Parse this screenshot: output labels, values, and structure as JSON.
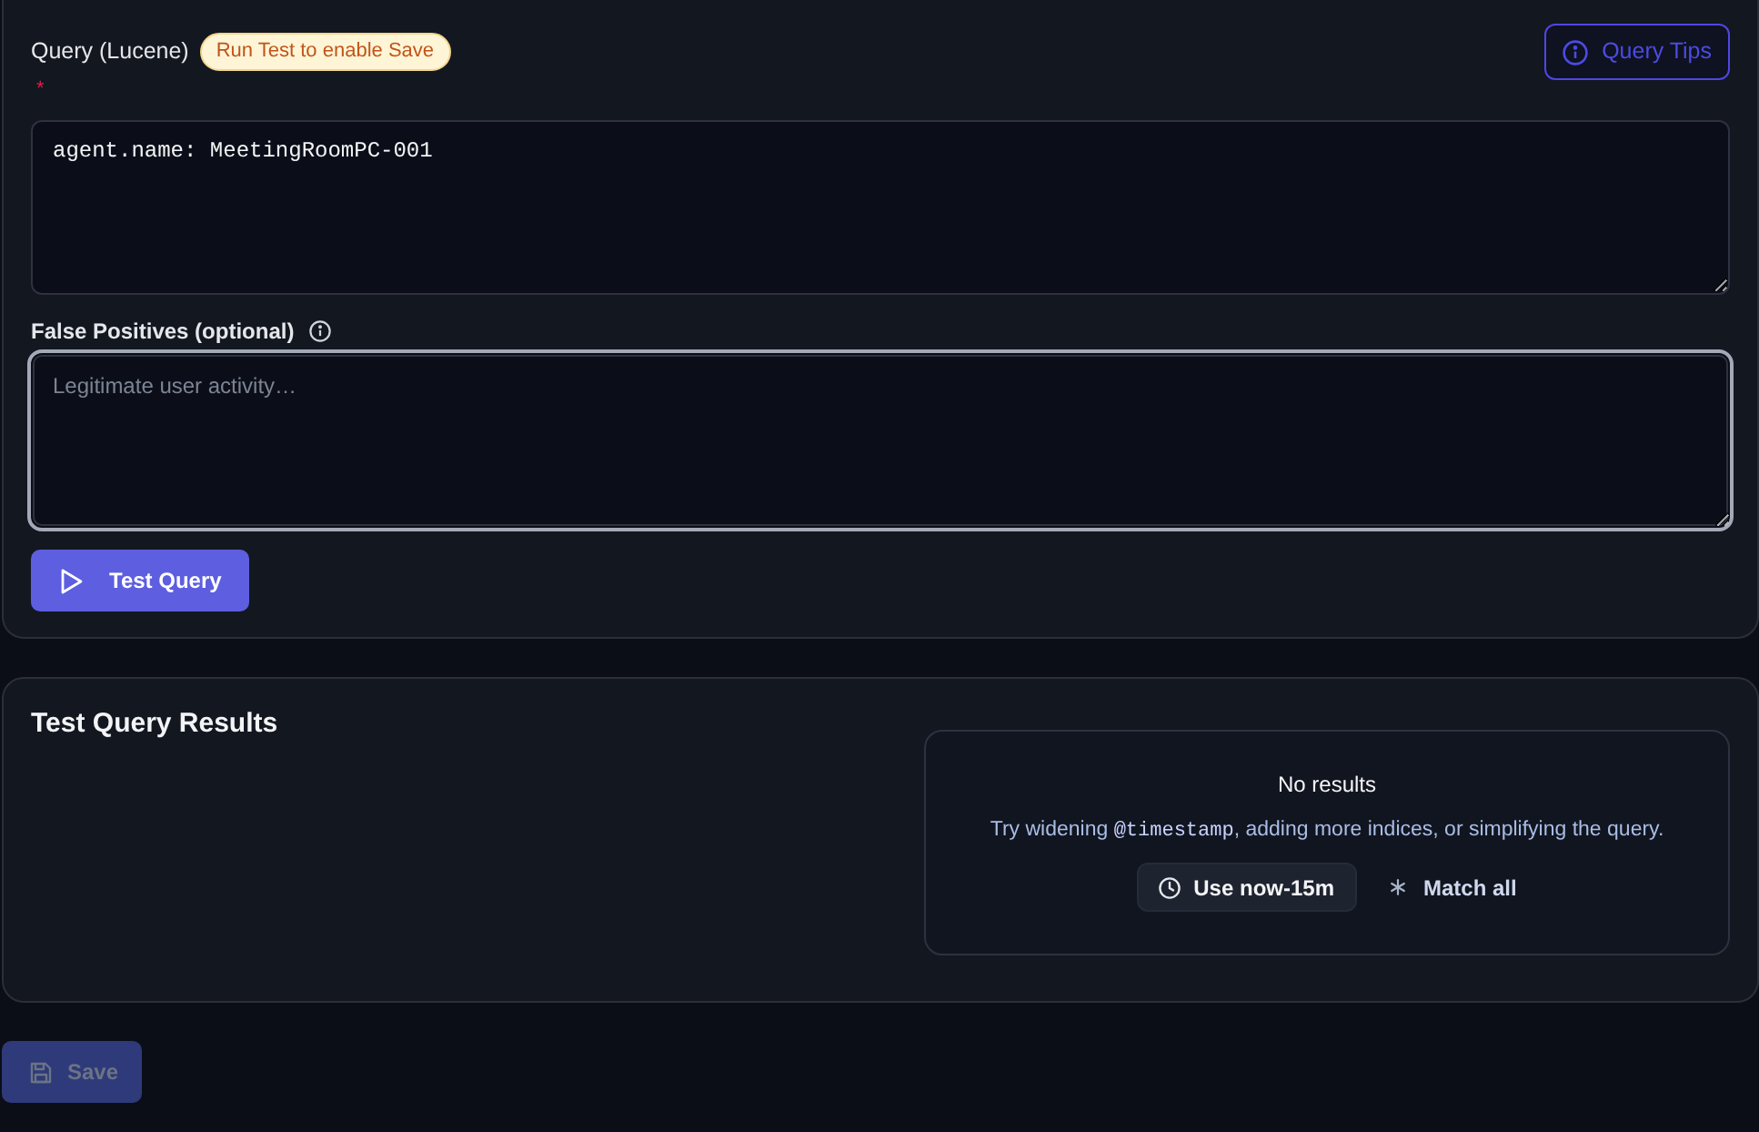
{
  "query": {
    "label": "Query (Lucene)",
    "badge": "Run Test to enable Save",
    "required_mark": "*",
    "tips_button": "Query Tips",
    "value": "agent.name: MeetingRoomPC-001"
  },
  "false_positives": {
    "label": "False Positives (optional)",
    "placeholder": "Legitimate user activity…",
    "focused": true
  },
  "test_button": "Test Query",
  "results": {
    "title": "Test Query Results",
    "empty_state": {
      "title": "No results",
      "message": [
        {
          "kind": "text",
          "text": "Try widening "
        },
        {
          "kind": "code",
          "text": "@timestamp"
        },
        {
          "kind": "text",
          "text": ", adding more indices, or simplifying the query."
        }
      ],
      "actions": [
        {
          "kind": "button",
          "label": "Use now-15m"
        },
        {
          "kind": "link",
          "label": "Match all"
        }
      ]
    }
  },
  "save_button": {
    "label": "Save",
    "disabled": true
  }
}
